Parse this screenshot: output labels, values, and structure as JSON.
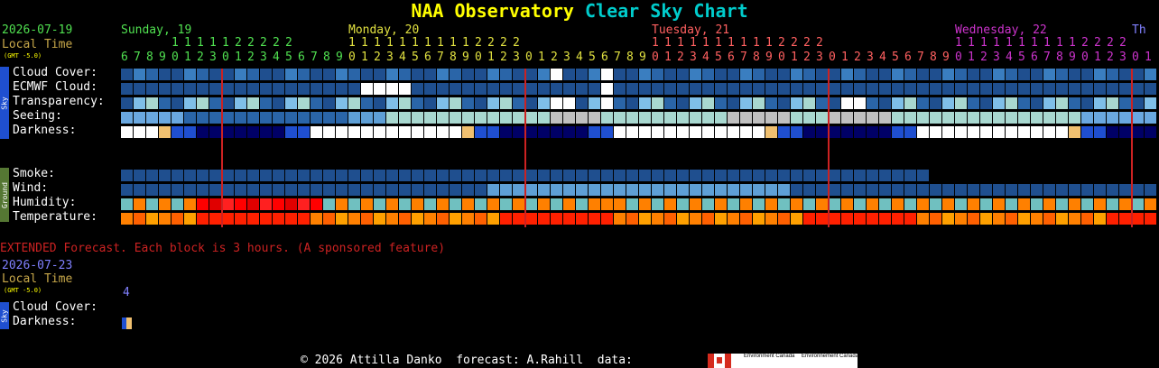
{
  "title": {
    "part1": "NAA Observatory",
    "part2": "Clear Sky Chart"
  },
  "header": {
    "date": "2026-07-19",
    "local_time": "Local Time",
    "gmt": "(GMT -5.0)"
  },
  "days": [
    {
      "label": "Sunday, 19",
      "color": "#50e050"
    },
    {
      "label": "Monday, 20",
      "color": "#e0e040"
    },
    {
      "label": "Tuesday, 21",
      "color": "#ff6060"
    },
    {
      "label": "Wednesday, 22",
      "color": "#cc33cc"
    },
    {
      "label": "Th",
      "color": "#8080ff"
    }
  ],
  "hours": {
    "day0_tens": "1111122222",
    "day0_units": "6789012301234567890123",
    "tens_block": "11111111112222",
    "full_units": "678901230123456789012345678901230123456789012345678901230123456789012345678901230123456789012345678901230123456789012301"
  },
  "sky_group": "Sky",
  "ground_group": "Ground",
  "rows": {
    "cloud": "Cloud Cover:",
    "ecmwf": "ECMWF Cloud:",
    "transparency": "Transparency:",
    "seeing": "Seeing:",
    "darkness": "Darkness:",
    "smoke": "Smoke:",
    "wind": "Wind:",
    "humidity": "Humidity:",
    "temperature": "Temperature:"
  },
  "extended": {
    "note": "EXTENDED Forecast. Each block is 3 hours. (A sponsored feature)",
    "date": "2026-07-23",
    "local_time": "Local Time",
    "gmt": "(GMT -5.0)",
    "hour": "4",
    "cloud": "Cloud Cover:",
    "darkness": "Darkness:"
  },
  "footer": {
    "copyright": "© 2026 Attilla Danko",
    "forecast": "forecast: A.Rahill",
    "data": "data:",
    "logo_en": "Environment Canada",
    "logo_fr": "Environnement Canada"
  }
}
